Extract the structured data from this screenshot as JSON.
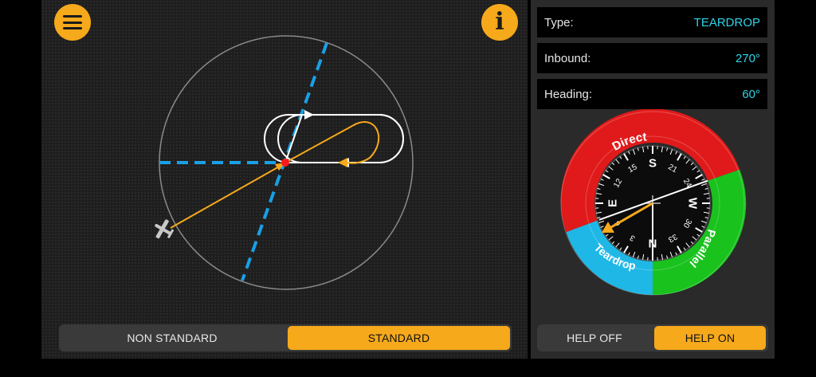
{
  "colors": {
    "accent": "#f6a91b",
    "value_text": "#2fd3e6",
    "direct_sector": "#e01a1a",
    "teardrop_sector": "#1fb8e6",
    "parallel_sector": "#19c21d",
    "inbound_course_line": "#19a0e6",
    "track_line": "#f6a91b"
  },
  "header": {
    "menu_icon": "hamburger-icon",
    "info_icon": "info-icon"
  },
  "info": {
    "type": {
      "label": "Type:",
      "value": "TEARDROP"
    },
    "inbound": {
      "label": "Inbound:",
      "value": "270°"
    },
    "heading": {
      "label": "Heading:",
      "value": "60°"
    }
  },
  "compass": {
    "sectors": {
      "direct": "Direct",
      "teardrop": "Teardrop",
      "parallel": "Parallel"
    },
    "cardinals": {
      "n": "N",
      "e": "E",
      "s": "S",
      "w": "W"
    },
    "tick_labels": [
      "3",
      "6",
      "12",
      "15",
      "21",
      "24",
      "30",
      "33"
    ],
    "heading_deg": 60,
    "inbound_deg": 270
  },
  "pattern": {
    "aircraft_icon": "airplane-icon",
    "fix_icon": "fix-point"
  },
  "standard_toggle": {
    "options": [
      "NON STANDARD",
      "STANDARD"
    ],
    "selected": "STANDARD"
  },
  "help_toggle": {
    "options": [
      "HELP OFF",
      "HELP ON"
    ],
    "selected": "HELP ON"
  }
}
